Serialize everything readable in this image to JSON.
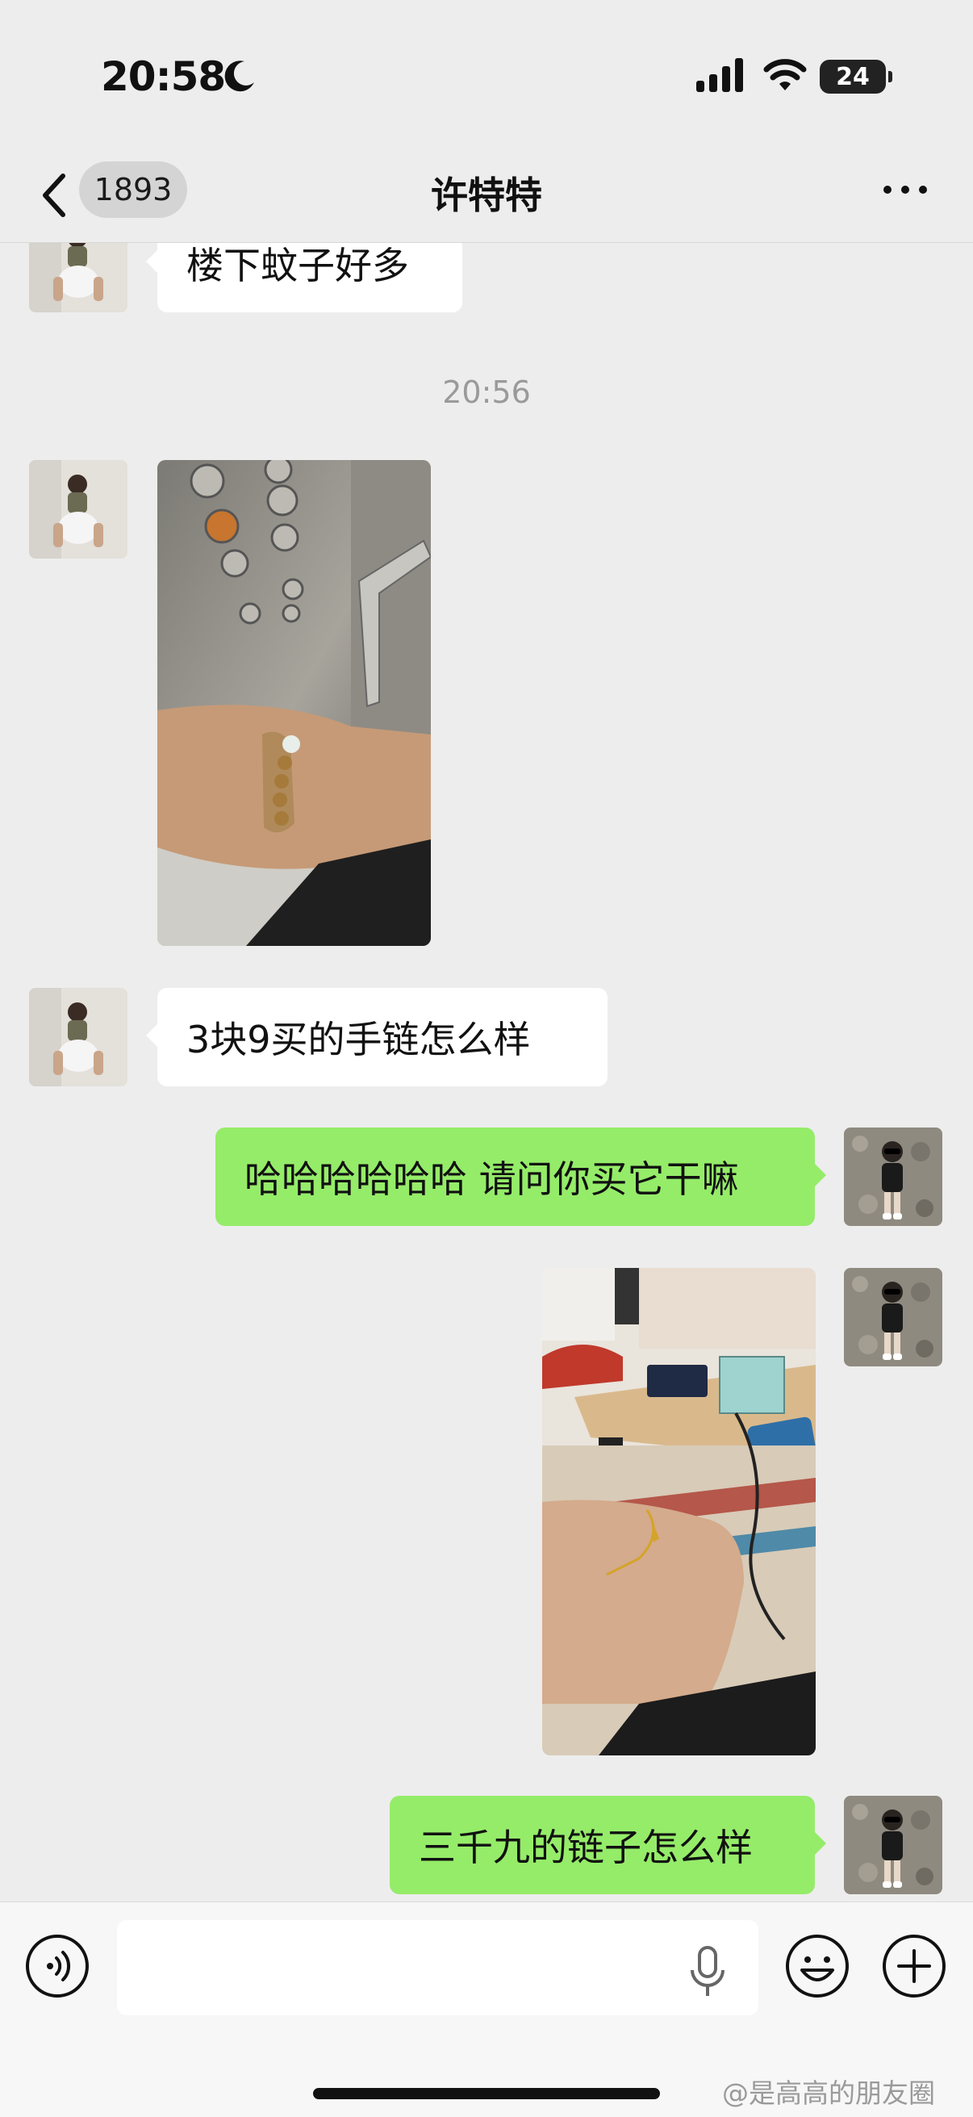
{
  "status_bar": {
    "time": "20:58",
    "battery": "24"
  },
  "header": {
    "unread_count": "1893",
    "title": "许特特"
  },
  "messages": {
    "m1_text": "楼下蚊子好多",
    "timestamp": "20:56",
    "m3_text": "3块9买的手链怎么样",
    "m4_text": "哈哈哈哈哈哈 请问你买它干嘛",
    "m6_text": "三千九的链子怎么样"
  },
  "composer": {
    "value": ""
  },
  "watermark": "@是高高的朋友圈",
  "icons": {
    "back": "chevron-left-icon",
    "more": "more-dots-icon",
    "voice": "voice-icon",
    "mic": "mic-icon",
    "emoji": "emoji-icon",
    "plus": "plus-icon"
  },
  "colors": {
    "background": "#ededed",
    "bubble_self": "#95ec69",
    "bubble_other": "#ffffff"
  }
}
